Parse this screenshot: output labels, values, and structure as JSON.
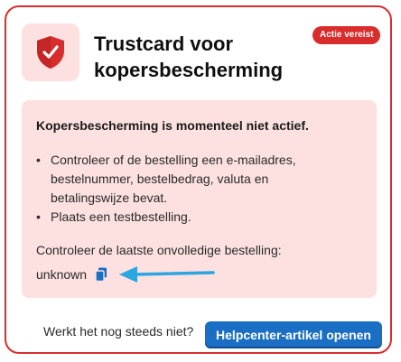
{
  "card": {
    "title": "Trustcard voor kopersbescherming",
    "badge": "Actie vereist",
    "icon": "shield-check-icon"
  },
  "banner": {
    "heading": "Kopersbescherming is momenteel niet actief.",
    "bullets": [
      "Controleer of de bestelling een e-mailadres, bestelnummer, bestelbedrag, valuta en betalingswijze bevat.",
      "Plaats een testbestelling."
    ],
    "check_label": "Controleer de laatste onvolledige bestelling:",
    "order_value": "unknown",
    "copy_icon": "copy-icon"
  },
  "footer": {
    "prompt": "Werkt het nog steeds niet?",
    "button_label": "Helpcenter-artikel openen"
  },
  "colors": {
    "accent_red": "#d92d2d",
    "banner_bg": "#fde1e1",
    "button_blue": "#1a6fc4",
    "arrow_blue": "#2ba6e0"
  }
}
